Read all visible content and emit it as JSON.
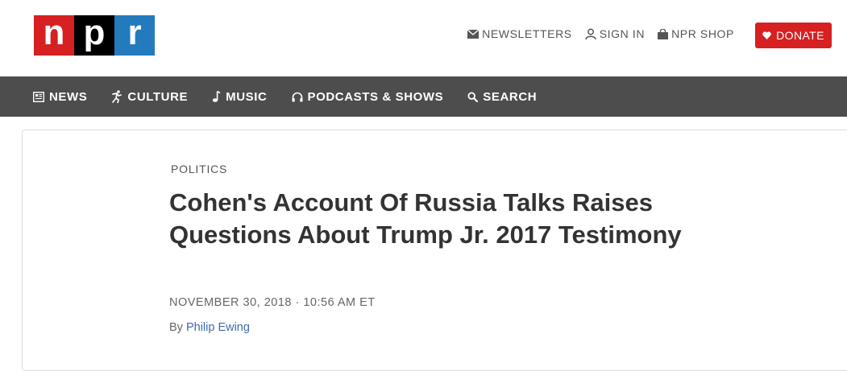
{
  "logo": {
    "letters": [
      "n",
      "p",
      "r"
    ]
  },
  "utility": {
    "newsletters": "NEWSLETTERS",
    "sign_in": "SIGN IN",
    "shop": "NPR SHOP",
    "donate": "DONATE"
  },
  "nav": {
    "items": [
      {
        "label": "NEWS",
        "icon": "news-icon"
      },
      {
        "label": "CULTURE",
        "icon": "culture-icon"
      },
      {
        "label": "MUSIC",
        "icon": "music-note-icon"
      },
      {
        "label": "PODCASTS & SHOWS",
        "icon": "headphones-icon"
      },
      {
        "label": "SEARCH",
        "icon": "search-icon"
      }
    ]
  },
  "article": {
    "slug": "POLITICS",
    "headline": "Cohen's Account Of Russia Talks Raises Questions About Trump Jr. 2017 Testimony",
    "date": "NOVEMBER 30, 2018 · 10:56 AM ET",
    "by": "By",
    "author": "Philip Ewing"
  },
  "colors": {
    "brand_red": "#d62021",
    "brand_blue": "#237bbd",
    "nav_bg": "#4d4d4d",
    "link": "#3f6ba9"
  }
}
